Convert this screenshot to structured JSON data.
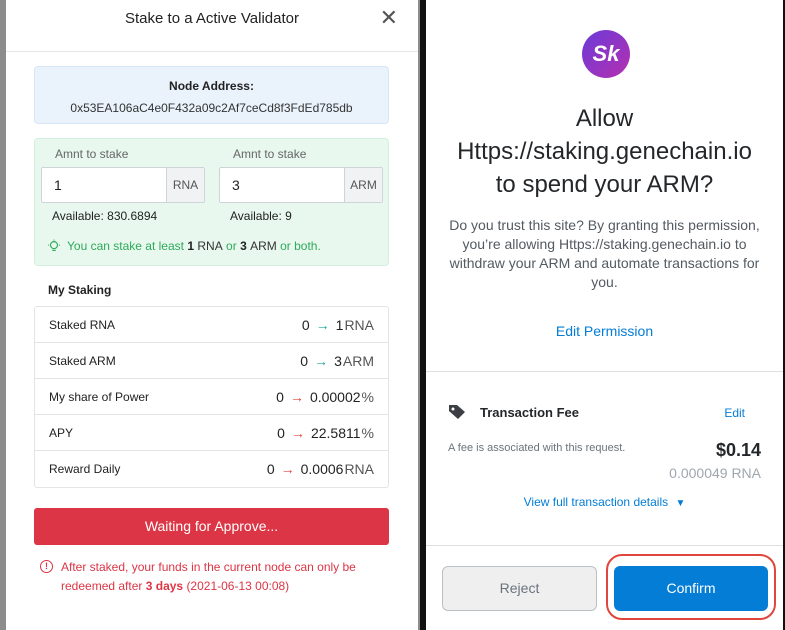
{
  "modal": {
    "title": "Stake to a Active Validator",
    "close": "✕",
    "node": {
      "label": "Node Address:",
      "value": "0x53EA106aC4e0F432a09c2Af7ceCd8f3FdEd785db"
    },
    "fields": [
      {
        "label": "Amnt to stake",
        "value": "1",
        "unit": "RNA",
        "available": "Available: 830.6894"
      },
      {
        "label": "Amnt to stake",
        "value": "3",
        "unit": "ARM",
        "available": "Available: 9"
      }
    ],
    "hint": {
      "prefix": "You can stake at least",
      "n1": "1",
      "u1": "RNA",
      "or": "or",
      "n2": "3",
      "u2": "ARM",
      "suffix": "or both."
    },
    "my_staking_title": "My Staking",
    "rows": [
      {
        "name": "Staked RNA",
        "from": "0",
        "to": "1",
        "unit": "RNA",
        "arrow": "green"
      },
      {
        "name": "Staked ARM",
        "from": "0",
        "to": "3",
        "unit": "ARM",
        "arrow": "green"
      },
      {
        "name": "My share of Power",
        "from": "0",
        "to": "0.00002",
        "unit": "%",
        "arrow": "red"
      },
      {
        "name": "APY",
        "from": "0",
        "to": "22.5811",
        "unit": "%",
        "arrow": "red"
      },
      {
        "name": "Reward Daily",
        "from": "0",
        "to": "0.0006",
        "unit": "RNA",
        "arrow": "red"
      }
    ],
    "button": "Waiting for Approve...",
    "warning": {
      "text": "After staked, your funds in the current node can only be redeemed after",
      "bold": "3 days",
      "date": "(2021-06-13 00:08)"
    }
  },
  "metamask": {
    "logo": "Sk",
    "title_line1": "Allow",
    "title_line2": "Https://staking.genechain.io",
    "title_line3": "to spend your ARM?",
    "desc": "Do you trust this site? By granting this permission, you’re allowing Https://staking.genechain.io to withdraw your ARM and automate transactions for you.",
    "edit_permission": "Edit Permission",
    "fee_title": "Transaction Fee",
    "fee_edit": "Edit",
    "fee_note": "A fee is associated with this request.",
    "fee_usd": "$0.14",
    "fee_rna": "0.000049 RNA",
    "view_details": "View full transaction details",
    "reject": "Reject",
    "confirm": "Confirm"
  }
}
